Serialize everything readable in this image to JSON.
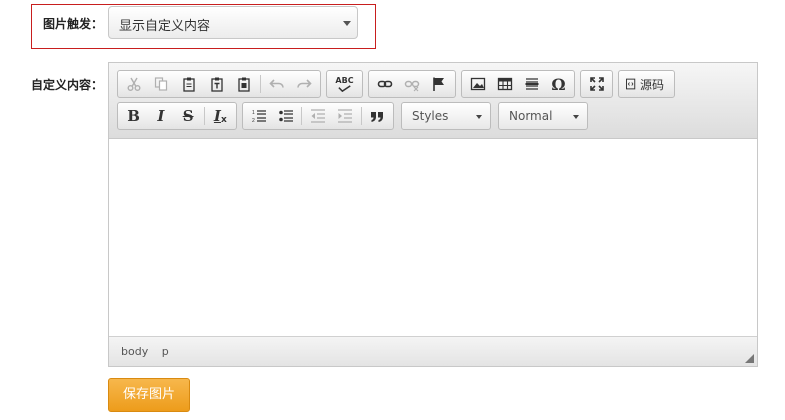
{
  "form": {
    "trigger_label": "图片触发：",
    "trigger_value": "显示自定义内容",
    "content_label": "自定义内容：",
    "save_label": "保存图片"
  },
  "toolbar": {
    "spellcheck_label": "ABC",
    "special_char_label": "Ω",
    "source_label": "源码",
    "bold_label": "B",
    "italic_label": "I",
    "strike_label": "S",
    "clear_format_label": "I",
    "clear_format_sub": "x",
    "styles_label": "Styles",
    "format_label": "Normal"
  },
  "statusbar": {
    "path": [
      "body",
      "p"
    ]
  },
  "colors": {
    "highlight": "#c81e1e",
    "save_button": "#f0a12a"
  }
}
